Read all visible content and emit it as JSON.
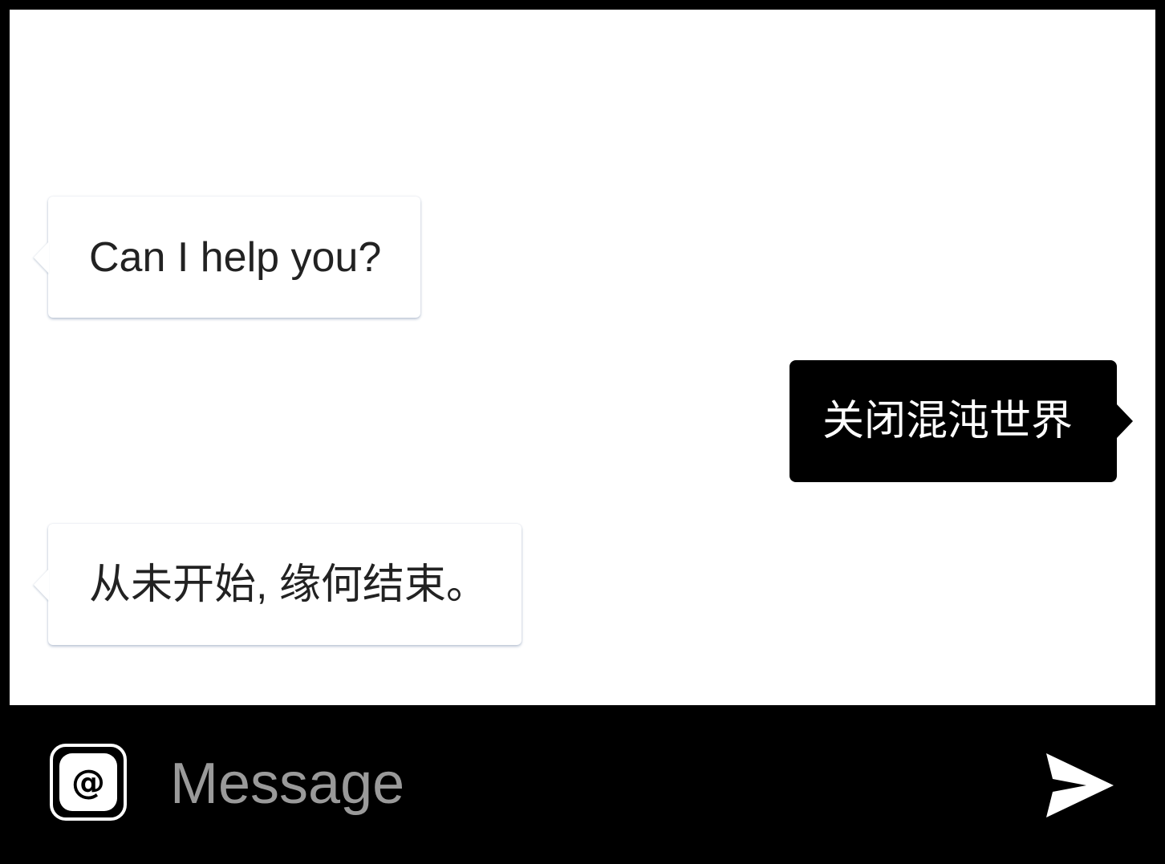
{
  "chat": {
    "messages": [
      {
        "direction": "incoming",
        "text": "Can I help you?"
      },
      {
        "direction": "outgoing",
        "text": "关闭混沌世界"
      },
      {
        "direction": "incoming",
        "text": "从未开始, 缘何结束。"
      }
    ]
  },
  "composer": {
    "mention_icon": "@",
    "mention_icon_name": "at-sign-icon",
    "placeholder": "Message",
    "value": "",
    "send_icon_name": "send-icon"
  },
  "colors": {
    "background": "#000000",
    "chat_background": "#ffffff",
    "incoming_bubble": "#ffffff",
    "incoming_text": "#222222",
    "outgoing_bubble": "#000000",
    "outgoing_text": "#ffffff",
    "placeholder": "#9a9a9a"
  }
}
